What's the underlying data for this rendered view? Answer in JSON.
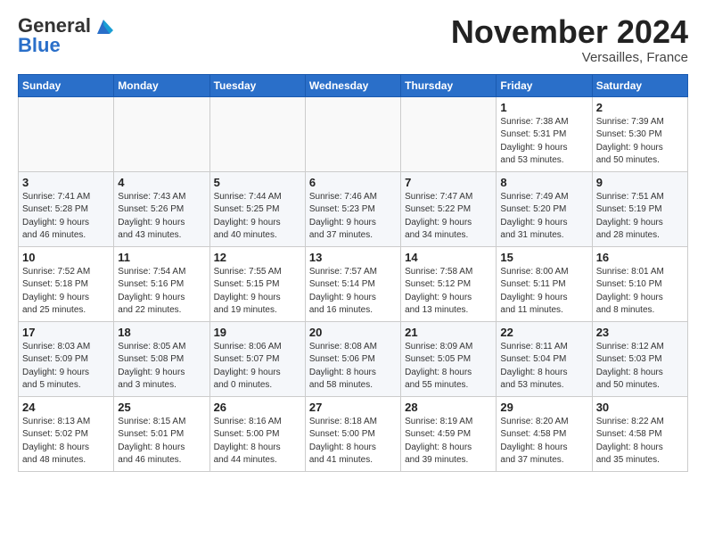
{
  "header": {
    "logo_general": "General",
    "logo_blue": "Blue",
    "month_title": "November 2024",
    "location": "Versailles, France"
  },
  "columns": [
    "Sunday",
    "Monday",
    "Tuesday",
    "Wednesday",
    "Thursday",
    "Friday",
    "Saturday"
  ],
  "weeks": [
    [
      {
        "day": "",
        "info": ""
      },
      {
        "day": "",
        "info": ""
      },
      {
        "day": "",
        "info": ""
      },
      {
        "day": "",
        "info": ""
      },
      {
        "day": "",
        "info": ""
      },
      {
        "day": "1",
        "info": "Sunrise: 7:38 AM\nSunset: 5:31 PM\nDaylight: 9 hours\nand 53 minutes."
      },
      {
        "day": "2",
        "info": "Sunrise: 7:39 AM\nSunset: 5:30 PM\nDaylight: 9 hours\nand 50 minutes."
      }
    ],
    [
      {
        "day": "3",
        "info": "Sunrise: 7:41 AM\nSunset: 5:28 PM\nDaylight: 9 hours\nand 46 minutes."
      },
      {
        "day": "4",
        "info": "Sunrise: 7:43 AM\nSunset: 5:26 PM\nDaylight: 9 hours\nand 43 minutes."
      },
      {
        "day": "5",
        "info": "Sunrise: 7:44 AM\nSunset: 5:25 PM\nDaylight: 9 hours\nand 40 minutes."
      },
      {
        "day": "6",
        "info": "Sunrise: 7:46 AM\nSunset: 5:23 PM\nDaylight: 9 hours\nand 37 minutes."
      },
      {
        "day": "7",
        "info": "Sunrise: 7:47 AM\nSunset: 5:22 PM\nDaylight: 9 hours\nand 34 minutes."
      },
      {
        "day": "8",
        "info": "Sunrise: 7:49 AM\nSunset: 5:20 PM\nDaylight: 9 hours\nand 31 minutes."
      },
      {
        "day": "9",
        "info": "Sunrise: 7:51 AM\nSunset: 5:19 PM\nDaylight: 9 hours\nand 28 minutes."
      }
    ],
    [
      {
        "day": "10",
        "info": "Sunrise: 7:52 AM\nSunset: 5:18 PM\nDaylight: 9 hours\nand 25 minutes."
      },
      {
        "day": "11",
        "info": "Sunrise: 7:54 AM\nSunset: 5:16 PM\nDaylight: 9 hours\nand 22 minutes."
      },
      {
        "day": "12",
        "info": "Sunrise: 7:55 AM\nSunset: 5:15 PM\nDaylight: 9 hours\nand 19 minutes."
      },
      {
        "day": "13",
        "info": "Sunrise: 7:57 AM\nSunset: 5:14 PM\nDaylight: 9 hours\nand 16 minutes."
      },
      {
        "day": "14",
        "info": "Sunrise: 7:58 AM\nSunset: 5:12 PM\nDaylight: 9 hours\nand 13 minutes."
      },
      {
        "day": "15",
        "info": "Sunrise: 8:00 AM\nSunset: 5:11 PM\nDaylight: 9 hours\nand 11 minutes."
      },
      {
        "day": "16",
        "info": "Sunrise: 8:01 AM\nSunset: 5:10 PM\nDaylight: 9 hours\nand 8 minutes."
      }
    ],
    [
      {
        "day": "17",
        "info": "Sunrise: 8:03 AM\nSunset: 5:09 PM\nDaylight: 9 hours\nand 5 minutes."
      },
      {
        "day": "18",
        "info": "Sunrise: 8:05 AM\nSunset: 5:08 PM\nDaylight: 9 hours\nand 3 minutes."
      },
      {
        "day": "19",
        "info": "Sunrise: 8:06 AM\nSunset: 5:07 PM\nDaylight: 9 hours\nand 0 minutes."
      },
      {
        "day": "20",
        "info": "Sunrise: 8:08 AM\nSunset: 5:06 PM\nDaylight: 8 hours\nand 58 minutes."
      },
      {
        "day": "21",
        "info": "Sunrise: 8:09 AM\nSunset: 5:05 PM\nDaylight: 8 hours\nand 55 minutes."
      },
      {
        "day": "22",
        "info": "Sunrise: 8:11 AM\nSunset: 5:04 PM\nDaylight: 8 hours\nand 53 minutes."
      },
      {
        "day": "23",
        "info": "Sunrise: 8:12 AM\nSunset: 5:03 PM\nDaylight: 8 hours\nand 50 minutes."
      }
    ],
    [
      {
        "day": "24",
        "info": "Sunrise: 8:13 AM\nSunset: 5:02 PM\nDaylight: 8 hours\nand 48 minutes."
      },
      {
        "day": "25",
        "info": "Sunrise: 8:15 AM\nSunset: 5:01 PM\nDaylight: 8 hours\nand 46 minutes."
      },
      {
        "day": "26",
        "info": "Sunrise: 8:16 AM\nSunset: 5:00 PM\nDaylight: 8 hours\nand 44 minutes."
      },
      {
        "day": "27",
        "info": "Sunrise: 8:18 AM\nSunset: 5:00 PM\nDaylight: 8 hours\nand 41 minutes."
      },
      {
        "day": "28",
        "info": "Sunrise: 8:19 AM\nSunset: 4:59 PM\nDaylight: 8 hours\nand 39 minutes."
      },
      {
        "day": "29",
        "info": "Sunrise: 8:20 AM\nSunset: 4:58 PM\nDaylight: 8 hours\nand 37 minutes."
      },
      {
        "day": "30",
        "info": "Sunrise: 8:22 AM\nSunset: 4:58 PM\nDaylight: 8 hours\nand 35 minutes."
      }
    ]
  ]
}
